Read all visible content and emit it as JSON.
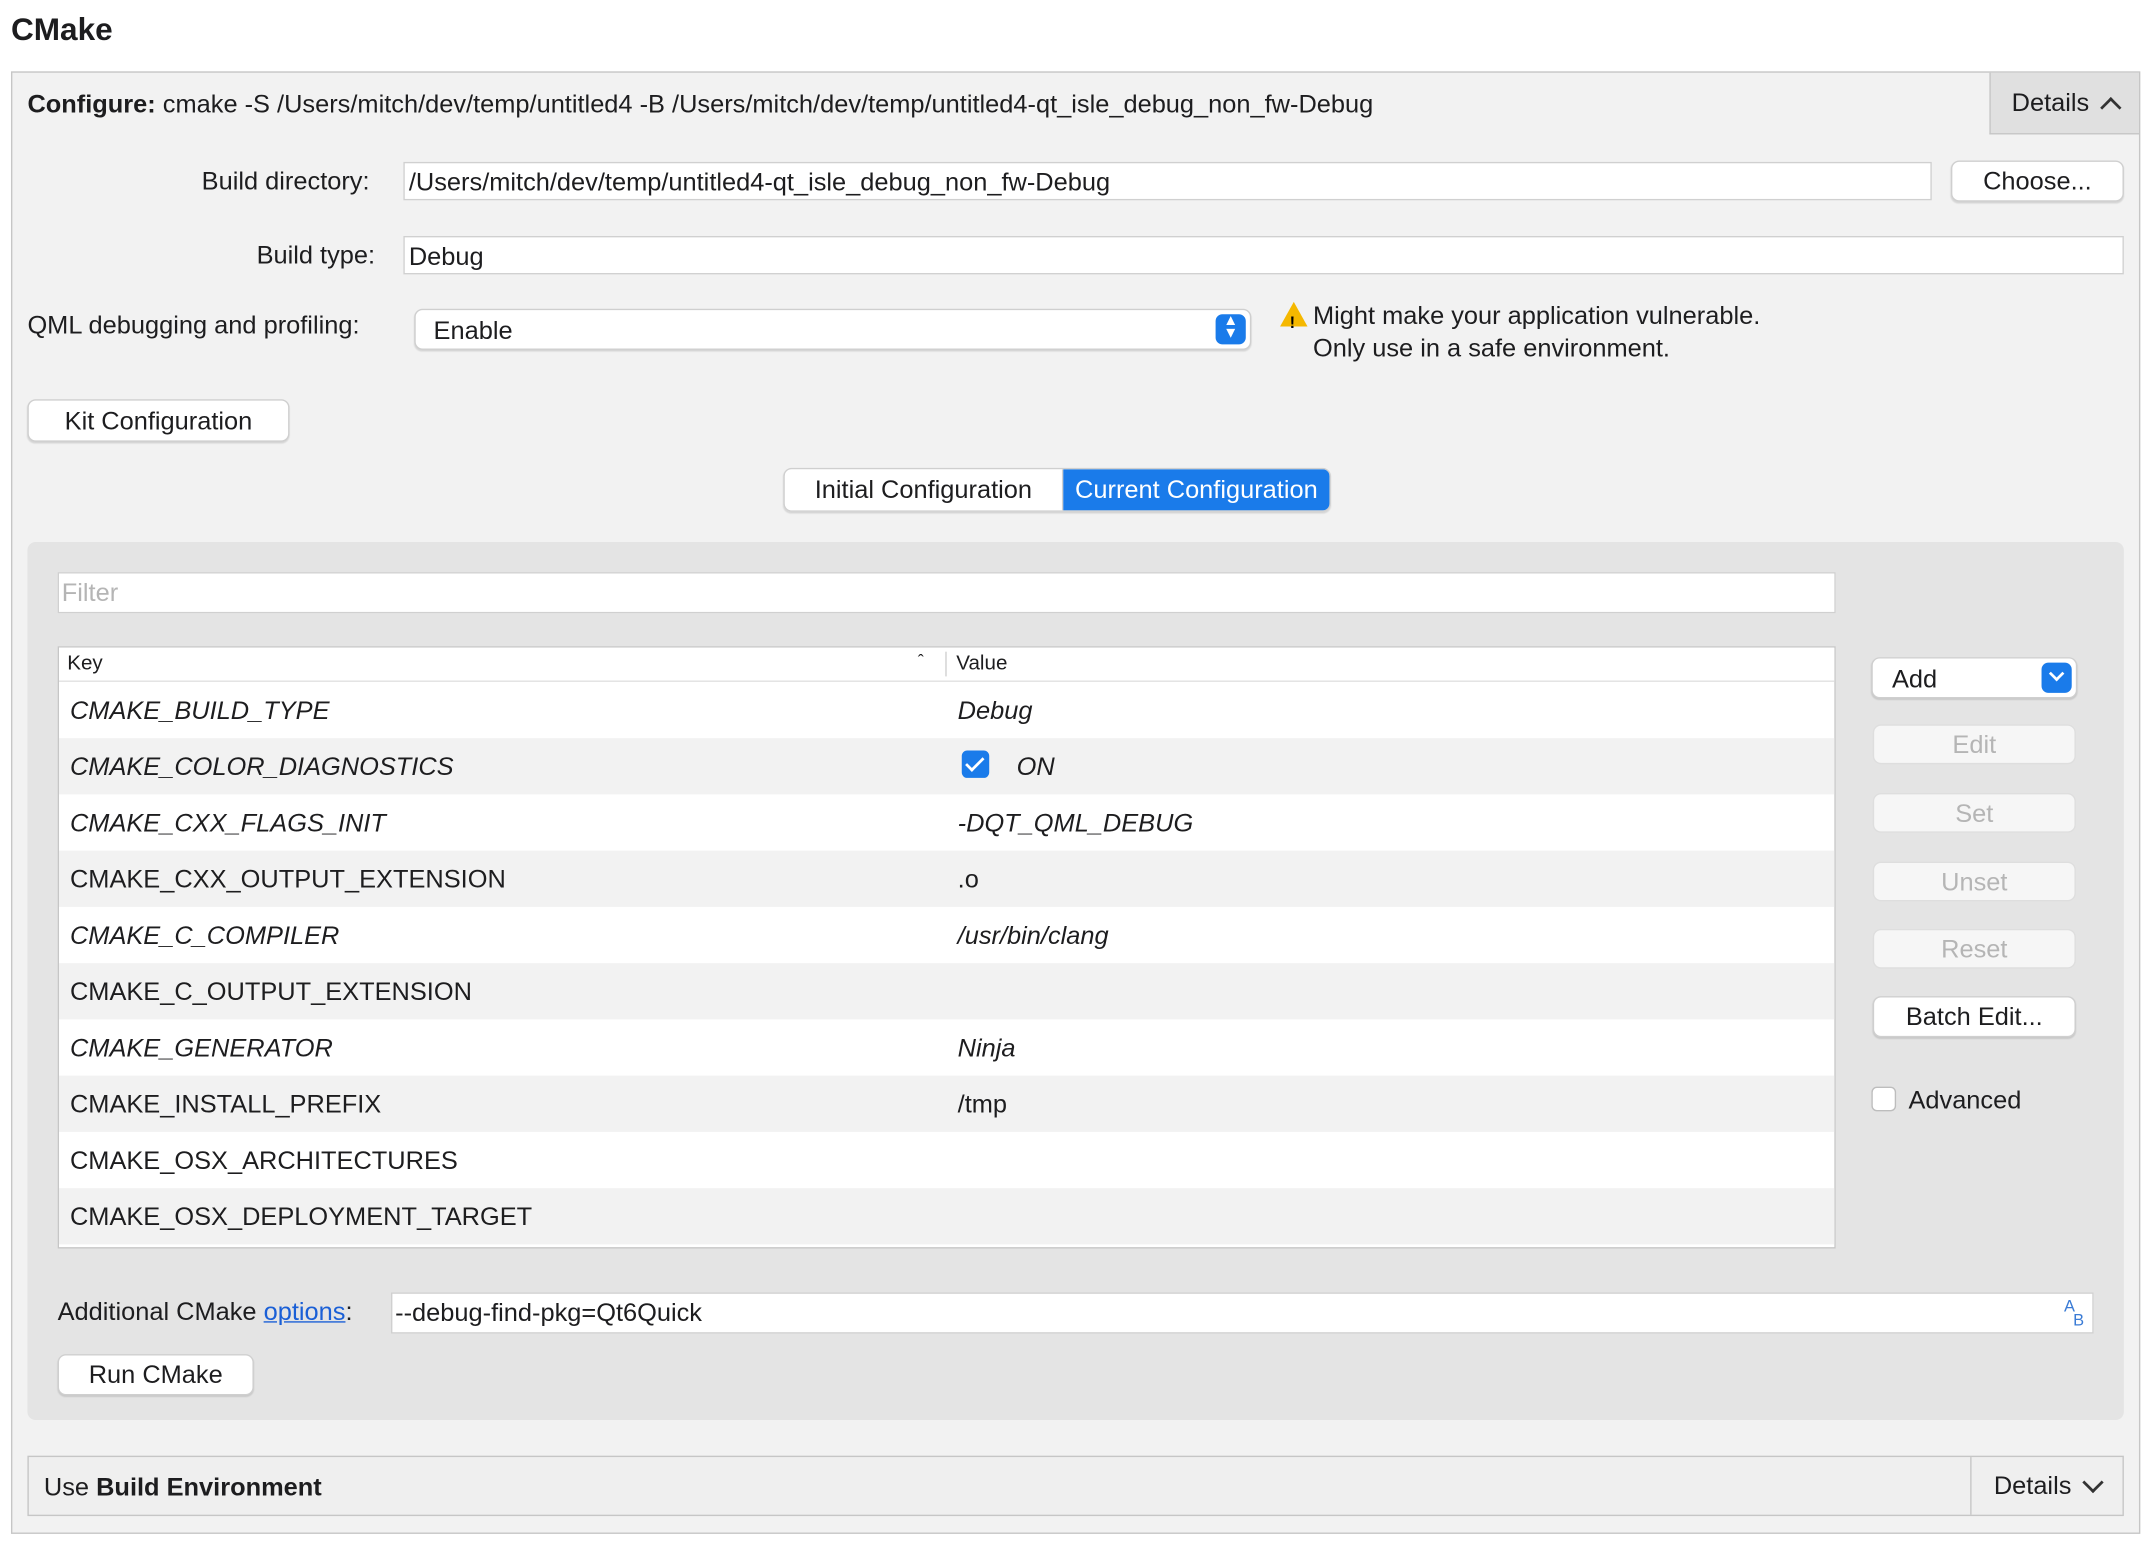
{
  "section_title": "CMake",
  "configure": {
    "label": "Configure:",
    "command": "cmake -S /Users/mitch/dev/temp/untitled4 -B /Users/mitch/dev/temp/untitled4-qt_isle_debug_non_fw-Debug",
    "details_label": "Details"
  },
  "build_directory": {
    "label": "Build directory:",
    "value": "/Users/mitch/dev/temp/untitled4-qt_isle_debug_non_fw-Debug",
    "choose_label": "Choose..."
  },
  "build_type": {
    "label": "Build type:",
    "value": "Debug"
  },
  "qml_debugging": {
    "label": "QML debugging and profiling:",
    "value": "Enable",
    "warning_line1": "Might make your application vulnerable.",
    "warning_line2": "Only use in a safe environment."
  },
  "kit_configuration_label": "Kit Configuration",
  "config_tabs": {
    "initial": "Initial Configuration",
    "current": "Current Configuration"
  },
  "filter_placeholder": "Filter",
  "table": {
    "headers": {
      "key": "Key",
      "value": "Value"
    },
    "rows": [
      {
        "key": "CMAKE_BUILD_TYPE",
        "value": "Debug"
      },
      {
        "key": "CMAKE_COLOR_DIAGNOSTICS",
        "value": "ON"
      },
      {
        "key": "CMAKE_CXX_FLAGS_INIT",
        "value": "-DQT_QML_DEBUG"
      },
      {
        "key": "CMAKE_CXX_OUTPUT_EXTENSION",
        "value": ".o"
      },
      {
        "key": "CMAKE_C_COMPILER",
        "value": "/usr/bin/clang"
      },
      {
        "key": "CMAKE_C_OUTPUT_EXTENSION",
        "value": ""
      },
      {
        "key": "CMAKE_GENERATOR",
        "value": "Ninja"
      },
      {
        "key": "CMAKE_INSTALL_PREFIX",
        "value": "/tmp"
      },
      {
        "key": "CMAKE_OSX_ARCHITECTURES",
        "value": ""
      },
      {
        "key": "CMAKE_OSX_DEPLOYMENT_TARGET",
        "value": ""
      }
    ]
  },
  "side_buttons": {
    "add": "Add",
    "edit": "Edit",
    "set": "Set",
    "unset": "Unset",
    "reset": "Reset",
    "batch_edit": "Batch Edit...",
    "advanced": "Advanced"
  },
  "additional_options": {
    "label_prefix": "Additional CMake ",
    "link": "options",
    "label_suffix": ":",
    "value": "--debug-find-pkg=Qt6Quick"
  },
  "run_cmake_label": "Run CMake",
  "build_environment": {
    "prefix": "Use ",
    "bold": "Build Environment",
    "details_label": "Details"
  },
  "colors": {
    "accent": "#1a7bea",
    "warning": "#f5b800",
    "link": "#1a5fd6"
  },
  "icons": {
    "details_expand": "chevron-up-icon",
    "env_details": "chevron-down-icon",
    "combo": "updown-arrows-icon",
    "warning": "warning-triangle-icon",
    "sort": "sort-ascending-icon",
    "field_action": "text-case-icon"
  }
}
